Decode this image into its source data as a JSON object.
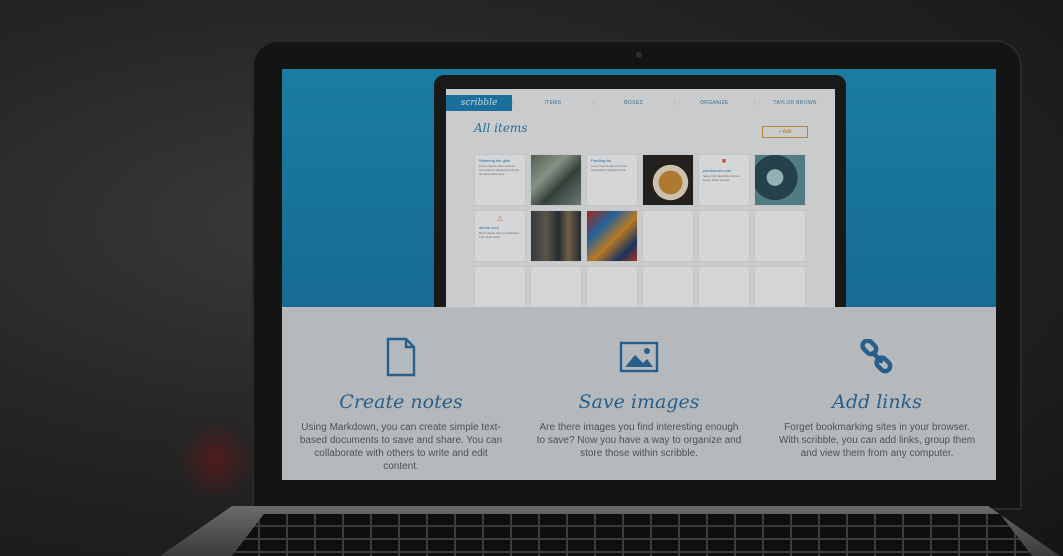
{
  "colors": {
    "accent_blue": "#2c6ca0",
    "hero_blue": "#1e8fb8",
    "add_orange": "#d39a3e"
  },
  "inner_app": {
    "logo": "scribble",
    "nav": [
      "ITEMS",
      "BOXES",
      "ORGANIZE",
      "TAYLOR BROWN"
    ],
    "title": "All items",
    "add_button": "+ Add",
    "cards": [
      {
        "type": "note",
        "title": "Watering the gifts",
        "body": "Lorem ipsum dolor sit amet consectetur adipiscing elit sed do eiusmod tempor"
      },
      {
        "type": "image",
        "style": "img-bridge"
      },
      {
        "type": "note",
        "title": "Packing list",
        "body": "Lorem ipsum dolor sit amet consectetur adipiscing elit"
      },
      {
        "type": "image",
        "style": "img-pancake"
      },
      {
        "type": "link",
        "icon": "■",
        "title": "youdomain.com",
        "body": "Some link description lorem ipsum dolor sit amet"
      },
      {
        "type": "image",
        "style": "img-water"
      },
      {
        "type": "link",
        "icon": "△",
        "title": "airbnb.com",
        "body": "Rent unique accommodations from local hosts"
      },
      {
        "type": "image",
        "style": "img-lights"
      },
      {
        "type": "image",
        "style": "img-graffiti"
      },
      {
        "type": "empty"
      },
      {
        "type": "empty"
      },
      {
        "type": "empty"
      },
      {
        "type": "empty"
      },
      {
        "type": "empty"
      },
      {
        "type": "empty"
      },
      {
        "type": "empty"
      },
      {
        "type": "empty"
      },
      {
        "type": "empty"
      }
    ]
  },
  "features": [
    {
      "icon": "document-icon",
      "title": "Create notes",
      "desc": "Using Markdown, you can create simple text-based documents to save and share. You can collaborate with others to write and edit content."
    },
    {
      "icon": "image-icon",
      "title": "Save images",
      "desc": "Are there images you find interesting enough to save? Now you have a way to organize and store those within scribble."
    },
    {
      "icon": "link-icon",
      "title": "Add links",
      "desc": "Forget bookmarking sites in your browser. With scribble, you can add links, group them and view them from any computer."
    }
  ]
}
